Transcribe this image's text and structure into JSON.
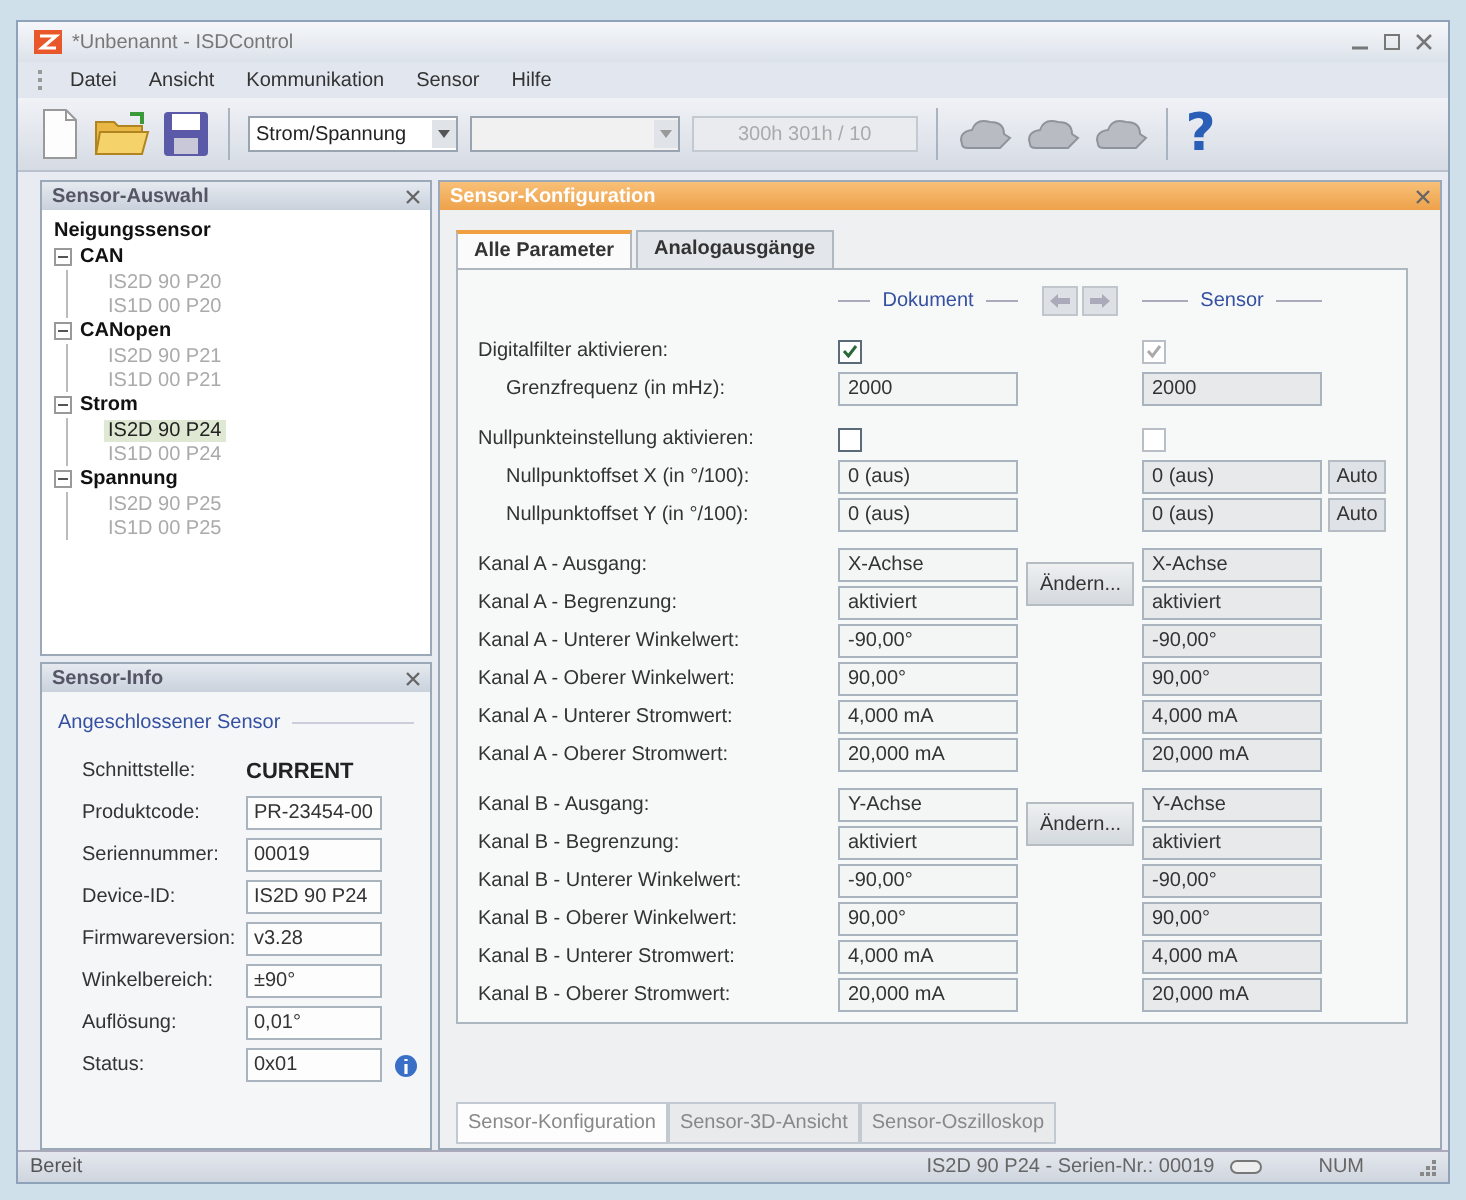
{
  "window": {
    "title": "*Unbenannt - ISDControl"
  },
  "menu": [
    "Datei",
    "Ansicht",
    "Kommunikation",
    "Sensor",
    "Hilfe"
  ],
  "toolbar": {
    "mode_select": "Strom/Spannung",
    "address_button": {
      "label": "300h 301h / 10",
      "disabled": true
    },
    "help": "?"
  },
  "selection_panel": {
    "title": "Sensor-Auswahl",
    "tree": [
      {
        "label": "Neigungssensor",
        "children": [
          {
            "label": "CAN",
            "expanded": true,
            "children": [
              {
                "label": "IS2D 90 P20",
                "selected": false
              },
              {
                "label": "IS1D 00 P20",
                "selected": false
              }
            ]
          },
          {
            "label": "CANopen",
            "expanded": true,
            "children": [
              {
                "label": "IS2D 90 P21",
                "selected": false
              },
              {
                "label": "IS1D 00 P21",
                "selected": false
              }
            ]
          },
          {
            "label": "Strom",
            "expanded": true,
            "children": [
              {
                "label": "IS2D 90 P24",
                "selected": true
              },
              {
                "label": "IS1D 00 P24",
                "selected": false
              }
            ]
          },
          {
            "label": "Spannung",
            "expanded": true,
            "children": [
              {
                "label": "IS2D 90 P25",
                "selected": false
              },
              {
                "label": "IS1D 00 P25",
                "selected": false
              }
            ]
          }
        ]
      }
    ]
  },
  "info_panel": {
    "title": "Sensor-Info",
    "group": "Angeschlossener Sensor",
    "fields": [
      {
        "label": "Schnittstelle:",
        "value": "CURRENT",
        "kind": "text"
      },
      {
        "label": "Produktcode:",
        "value": "PR-23454-00",
        "kind": "field"
      },
      {
        "label": "Seriennummer:",
        "value": "00019",
        "kind": "field"
      },
      {
        "label": "Device-ID:",
        "value": "IS2D 90 P24",
        "kind": "field"
      },
      {
        "label": "Firmwareversion:",
        "value": "v3.28",
        "kind": "field"
      },
      {
        "label": "Winkelbereich:",
        "value": "±90°",
        "kind": "field"
      },
      {
        "label": "Auflösung:",
        "value": "0,01°",
        "kind": "field"
      },
      {
        "label": "Status:",
        "value": "0x01",
        "kind": "status"
      }
    ]
  },
  "config_panel": {
    "title": "Sensor-Konfiguration",
    "tabs": [
      {
        "label": "Alle Parameter",
        "selected": true
      },
      {
        "label": "Analogausgänge",
        "selected": false
      }
    ],
    "columns": {
      "document": "Dokument",
      "sensor": "Sensor"
    },
    "sections": [
      {
        "kind": "checkbox",
        "label": "Digitalfilter aktivieren:",
        "document_checked": true,
        "sensor_checked": true,
        "children": [
          {
            "label": "Grenzfrequenz (in mHz):",
            "document": "2000",
            "sensor": "2000"
          }
        ]
      },
      {
        "kind": "checkbox",
        "label": "Nullpunkteinstellung aktivieren:",
        "document_checked": false,
        "sensor_checked": false,
        "children": [
          {
            "label": "Nullpunktoffset X (in °/100):",
            "document": "0 (aus)",
            "sensor": "0 (aus)",
            "action": "Auto"
          },
          {
            "label": "Nullpunktoffset Y (in °/100):",
            "document": "0 (aus)",
            "sensor": "0 (aus)",
            "action": "Auto"
          }
        ]
      },
      {
        "kind": "channel",
        "action": "Ändern...",
        "rows": [
          {
            "label": "Kanal A - Ausgang:",
            "document": "X-Achse",
            "sensor": "X-Achse"
          },
          {
            "label": "Kanal A - Begrenzung:",
            "document": "aktiviert",
            "sensor": "aktiviert"
          },
          {
            "label": "Kanal A - Unterer Winkelwert:",
            "document": "-90,00°",
            "sensor": "-90,00°"
          },
          {
            "label": "Kanal A - Oberer Winkelwert:",
            "document": "90,00°",
            "sensor": "90,00°"
          },
          {
            "label": "Kanal A - Unterer Stromwert:",
            "document": "4,000 mA",
            "sensor": "4,000 mA"
          },
          {
            "label": "Kanal A - Oberer Stromwert:",
            "document": "20,000 mA",
            "sensor": "20,000 mA"
          }
        ]
      },
      {
        "kind": "channel",
        "action": "Ändern...",
        "rows": [
          {
            "label": "Kanal B - Ausgang:",
            "document": "Y-Achse",
            "sensor": "Y-Achse"
          },
          {
            "label": "Kanal B - Begrenzung:",
            "document": "aktiviert",
            "sensor": "aktiviert"
          },
          {
            "label": "Kanal B - Unterer Winkelwert:",
            "document": "-90,00°",
            "sensor": "-90,00°"
          },
          {
            "label": "Kanal B - Oberer Winkelwert:",
            "document": "90,00°",
            "sensor": "90,00°"
          },
          {
            "label": "Kanal B - Unterer Stromwert:",
            "document": "4,000 mA",
            "sensor": "4,000 mA"
          },
          {
            "label": "Kanal B - Oberer Stromwert:",
            "document": "20,000 mA",
            "sensor": "20,000 mA"
          }
        ]
      }
    ],
    "bottom_tabs": [
      {
        "label": "Sensor-Konfiguration",
        "selected": true
      },
      {
        "label": "Sensor-3D-Ansicht",
        "selected": false
      },
      {
        "label": "Sensor-Oszilloskop",
        "selected": false
      }
    ]
  },
  "status_bar": {
    "text": "Bereit",
    "device": "IS2D 90 P24 - Serien-Nr.: 00019",
    "num": "NUM"
  }
}
